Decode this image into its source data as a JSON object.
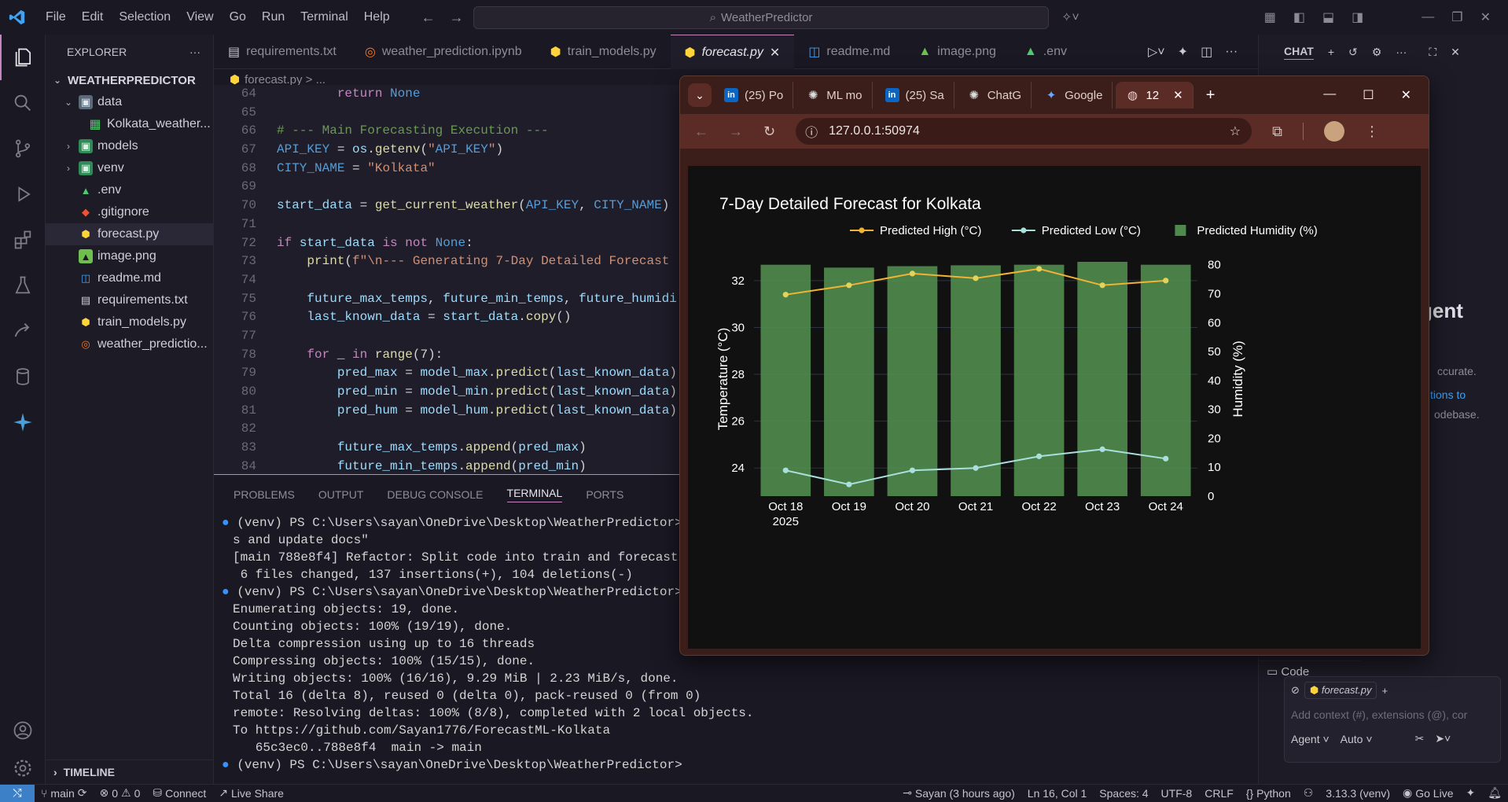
{
  "titlebar": {
    "menus": [
      "File",
      "Edit",
      "Selection",
      "View",
      "Go",
      "Run",
      "Terminal",
      "Help"
    ],
    "search": "WeatherPredictor"
  },
  "explorer": {
    "header": "EXPLORER",
    "root": "WEATHERPREDICTOR",
    "items": [
      {
        "label": "data",
        "kind": "folder",
        "open": true,
        "depth": 1
      },
      {
        "label": "Kolkata_weather...",
        "kind": "csv",
        "depth": 2
      },
      {
        "label": "models",
        "kind": "folder",
        "depth": 1
      },
      {
        "label": "venv",
        "kind": "folder",
        "depth": 1
      },
      {
        "label": ".env",
        "kind": "env",
        "depth": 1
      },
      {
        "label": ".gitignore",
        "kind": "git",
        "depth": 1
      },
      {
        "label": "forecast.py",
        "kind": "py",
        "depth": 1,
        "selected": true
      },
      {
        "label": "image.png",
        "kind": "img",
        "depth": 1
      },
      {
        "label": "readme.md",
        "kind": "md",
        "depth": 1
      },
      {
        "label": "requirements.txt",
        "kind": "txt",
        "depth": 1
      },
      {
        "label": "train_models.py",
        "kind": "py",
        "depth": 1
      },
      {
        "label": "weather_predictio...",
        "kind": "nb",
        "depth": 1
      }
    ],
    "timeline": "TIMELINE"
  },
  "tabs": [
    "requirements.txt",
    "weather_prediction.ipynb",
    "train_models.py",
    "forecast.py",
    "readme.md",
    "image.png",
    ".env"
  ],
  "active_tab": "forecast.py",
  "breadcrumb": "forecast.py > ...",
  "editor": {
    "lines": [
      {
        "n": "64",
        "t": "        return None"
      },
      {
        "n": "65",
        "t": ""
      },
      {
        "n": "66",
        "t": "# --- Main Forecasting Execution ---"
      },
      {
        "n": "67",
        "t": "API_KEY = os.getenv(\"API_KEY\")"
      },
      {
        "n": "68",
        "t": "CITY_NAME = \"Kolkata\""
      },
      {
        "n": "69",
        "t": ""
      },
      {
        "n": "70",
        "t": "start_data = get_current_weather(API_KEY, CITY_NAME)"
      },
      {
        "n": "71",
        "t": ""
      },
      {
        "n": "72",
        "t": "if start_data is not None:"
      },
      {
        "n": "73",
        "t": "    print(f\"\\n--- Generating 7-Day Detailed Forecast"
      },
      {
        "n": "74",
        "t": ""
      },
      {
        "n": "75",
        "t": "    future_max_temps, future_min_temps, future_humidi"
      },
      {
        "n": "76",
        "t": "    last_known_data = start_data.copy()"
      },
      {
        "n": "77",
        "t": ""
      },
      {
        "n": "78",
        "t": "    for _ in range(7):"
      },
      {
        "n": "79",
        "t": "        pred_max = model_max.predict(last_known_data)"
      },
      {
        "n": "80",
        "t": "        pred_min = model_min.predict(last_known_data)"
      },
      {
        "n": "81",
        "t": "        pred_hum = model_hum.predict(last_known_data)"
      },
      {
        "n": "82",
        "t": ""
      },
      {
        "n": "83",
        "t": "        future_max_temps.append(pred_max)"
      },
      {
        "n": "84",
        "t": "        future_min_temps.append(pred_min)"
      }
    ]
  },
  "panel": {
    "tabs": [
      "PROBLEMS",
      "OUTPUT",
      "DEBUG CONSOLE",
      "TERMINAL",
      "PORTS"
    ],
    "active": "TERMINAL",
    "lines": [
      "(venv) PS C:\\Users\\sayan\\OneDrive\\Desktop\\WeatherPredictor> git",
      "s and update docs\"",
      "[main 788e8f4] Refactor: Split code into train and forecast scr",
      " 6 files changed, 137 insertions(+), 104 deletions(-)",
      "(venv) PS C:\\Users\\sayan\\OneDrive\\Desktop\\WeatherPredictor> git",
      "Enumerating objects: 19, done.",
      "Counting objects: 100% (19/19), done.",
      "Delta compression using up to 16 threads",
      "Compressing objects: 100% (15/15), done.",
      "Writing objects: 100% (16/16), 9.29 MiB | 2.23 MiB/s, done.",
      "Total 16 (delta 8), reused 0 (delta 0), pack-reused 0 (from 0)",
      "remote: Resolving deltas: 100% (8/8), completed with 2 local objects.",
      "To https://github.com/Sayan1776/ForecastML-Kolkata",
      "   65c3ec0..788e8f4  main -> main",
      "(venv) PS C:\\Users\\sayan\\OneDrive\\Desktop\\WeatherPredictor> "
    ]
  },
  "chat": {
    "title": "CHAT",
    "partial_heading": "gent",
    "partial_lines": [
      "ccurate.",
      "tions to",
      "odebase."
    ],
    "code_item": "Code",
    "context_file": "forecast.py",
    "placeholder": "Add context (#), extensions (@), cor",
    "mode": "Agent",
    "model": "Auto"
  },
  "statusbar": {
    "branch": "main",
    "errors": "0",
    "warnings": "0",
    "connect": "Connect",
    "liveshare": "Live Share",
    "blame": "Sayan (3 hours ago)",
    "position": "Ln 16, Col 1",
    "spaces": "Spaces: 4",
    "encoding": "UTF-8",
    "eol": "CRLF",
    "language": "Python",
    "interpreter": "3.13.3 (venv)",
    "golive": "Go Live"
  },
  "browser": {
    "tabs": [
      "(25) Po",
      "ML mo",
      "(25) Sa",
      "ChatG",
      "Google",
      "12"
    ],
    "url": "127.0.0.1:50974"
  },
  "chart_data": {
    "type": "bar+line",
    "title": "7-Day Detailed Forecast for Kolkata",
    "categories": [
      "Oct 18",
      "Oct 19",
      "Oct 20",
      "Oct 21",
      "Oct 22",
      "Oct 23",
      "Oct 24"
    ],
    "x_first_sub": "2025",
    "ylabel": "Temperature (°C)",
    "y2label": "Humidity (%)",
    "ylim": [
      22.8,
      32.8
    ],
    "y2lim": [
      0,
      81
    ],
    "yticks": [
      24,
      26,
      28,
      30,
      32
    ],
    "y2ticks": [
      0,
      10,
      20,
      30,
      40,
      50,
      60,
      70,
      80
    ],
    "legend_position": "top",
    "series": [
      {
        "name": "Predicted High (°C)",
        "type": "line",
        "color": "#f2b233",
        "values": [
          31.4,
          31.8,
          32.3,
          32.1,
          32.5,
          31.8,
          32.0
        ]
      },
      {
        "name": "Predicted Low (°C)",
        "type": "line",
        "color": "#a9e0dc",
        "values": [
          23.9,
          23.3,
          23.9,
          24.0,
          24.5,
          24.8,
          24.4
        ]
      },
      {
        "name": "Predicted Humidity (%)",
        "type": "bar",
        "color": "#4f8a4d",
        "values": [
          80,
          79,
          79.5,
          79.8,
          80,
          81,
          80
        ]
      }
    ]
  }
}
